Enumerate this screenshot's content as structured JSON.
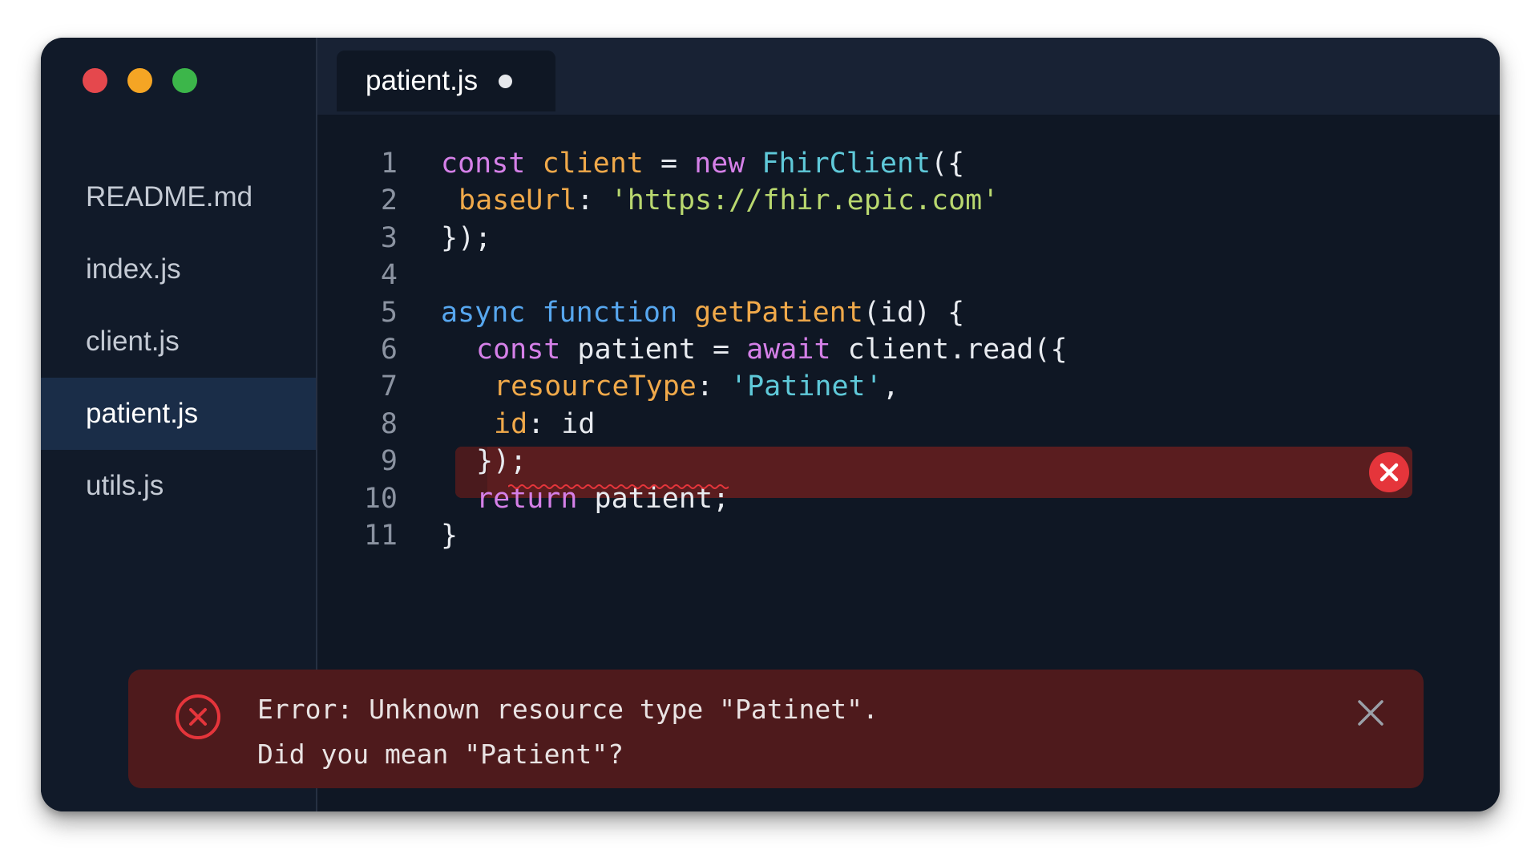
{
  "window": {
    "traffic_lights": [
      {
        "name": "close",
        "color": "#e5484d"
      },
      {
        "name": "minimize",
        "color": "#f5a524"
      },
      {
        "name": "maximize",
        "color": "#3cb64a"
      }
    ]
  },
  "sidebar": {
    "files": [
      {
        "label": "README.md",
        "active": false
      },
      {
        "label": "index.js",
        "active": false
      },
      {
        "label": "client.js",
        "active": false
      },
      {
        "label": "patient.js",
        "active": true
      },
      {
        "label": "utils.js",
        "active": false
      }
    ]
  },
  "tab": {
    "label": "patient.js",
    "modified_indicator": "unsaved-dot-icon"
  },
  "editor": {
    "error_line": 7,
    "lines": [
      {
        "number": "1",
        "indent": 0,
        "tokens": [
          {
            "t": "const",
            "c": "k-purple"
          },
          {
            "t": " ",
            "c": "k-white"
          },
          {
            "t": "client",
            "c": "k-orange"
          },
          {
            "t": " = ",
            "c": "k-white"
          },
          {
            "t": "new",
            "c": "k-purple"
          },
          {
            "t": " ",
            "c": "k-white"
          },
          {
            "t": "FhirClient",
            "c": "k-cyan"
          },
          {
            "t": "({",
            "c": "k-white"
          }
        ]
      },
      {
        "number": "2",
        "indent": 1,
        "tokens": [
          {
            "t": "baseUrl",
            "c": "k-orange"
          },
          {
            "t": ": ",
            "c": "k-white"
          },
          {
            "t": "'https://fhir.epic.com'",
            "c": "k-green"
          }
        ]
      },
      {
        "number": "3",
        "indent": 0,
        "tokens": [
          {
            "t": "});",
            "c": "k-white"
          }
        ]
      },
      {
        "number": "4",
        "indent": 0,
        "tokens": []
      },
      {
        "number": "5",
        "indent": 0,
        "tokens": [
          {
            "t": "async",
            "c": "k-blue"
          },
          {
            "t": " ",
            "c": "k-white"
          },
          {
            "t": "function",
            "c": "k-blue"
          },
          {
            "t": " ",
            "c": "k-white"
          },
          {
            "t": "getPatient",
            "c": "k-orange"
          },
          {
            "t": "(id) {",
            "c": "k-white"
          }
        ]
      },
      {
        "number": "6",
        "indent": 2,
        "tokens": [
          {
            "t": "const",
            "c": "k-purple"
          },
          {
            "t": " patient = ",
            "c": "k-white"
          },
          {
            "t": "await",
            "c": "k-purple"
          },
          {
            "t": " client.read({",
            "c": "k-white"
          }
        ]
      },
      {
        "number": "7",
        "indent": 3,
        "tokens": [
          {
            "t": "resourceType",
            "c": "k-orange"
          },
          {
            "t": ": ",
            "c": "k-white"
          },
          {
            "t": "'Patinet'",
            "c": "k-cyan"
          },
          {
            "t": ",",
            "c": "k-white"
          }
        ]
      },
      {
        "number": "8",
        "indent": 3,
        "tokens": [
          {
            "t": "id",
            "c": "k-orange"
          },
          {
            "t": ": id",
            "c": "k-white"
          }
        ]
      },
      {
        "number": "9",
        "indent": 2,
        "tokens": [
          {
            "t": "});",
            "c": "k-white"
          }
        ]
      },
      {
        "number": "10",
        "indent": 2,
        "tokens": [
          {
            "t": "return",
            "c": "k-purple"
          },
          {
            "t": " patient;",
            "c": "k-white"
          }
        ]
      },
      {
        "number": "11",
        "indent": 0,
        "tokens": [
          {
            "t": "}",
            "c": "k-white"
          }
        ]
      }
    ]
  },
  "error_panel": {
    "line1": "Error: Unknown resource type \"Patinet\".",
    "line2": "Did you mean \"Patient\"?",
    "icon": "error-circle-icon",
    "close_icon": "close-x-icon"
  },
  "colors": {
    "window_bg": "#0f1724",
    "sidebar_bg": "#111a29",
    "active_item_bg": "#1a2d48",
    "error_line_bg": "#5a1d1f",
    "error_panel_bg": "#4e1a1c",
    "error_red": "#e5353b"
  }
}
